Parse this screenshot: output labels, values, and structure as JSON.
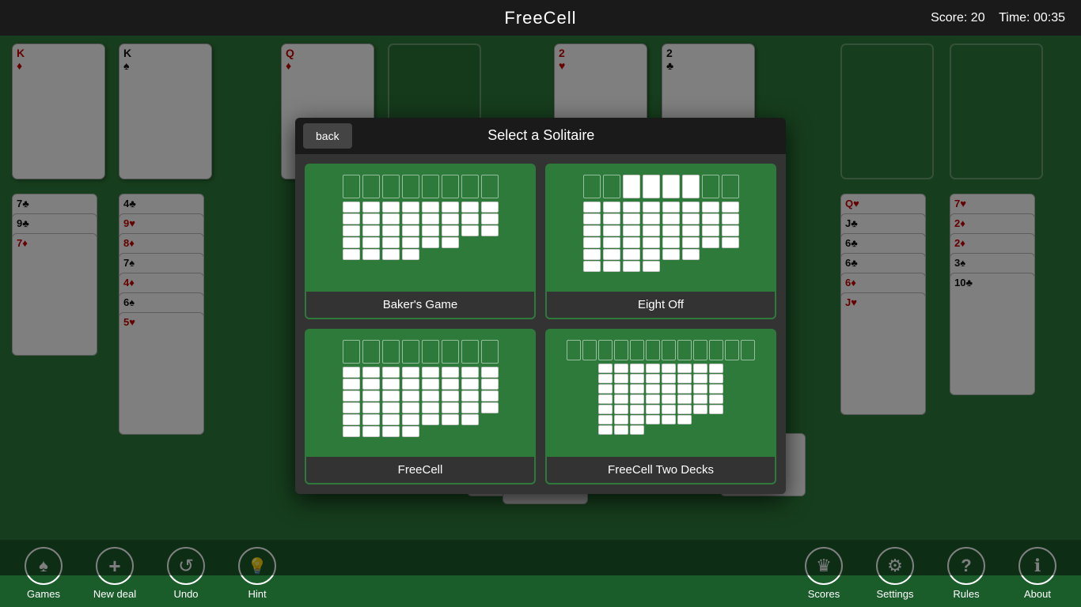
{
  "header": {
    "title": "FreeCell",
    "score_label": "Score:",
    "score_value": "20",
    "time_label": "Time:",
    "time_value": "00:35"
  },
  "toolbar": {
    "left_buttons": [
      {
        "id": "games",
        "label": "Games",
        "icon": "♠"
      },
      {
        "id": "new-deal",
        "label": "New deal",
        "icon": "+"
      },
      {
        "id": "undo",
        "label": "Undo",
        "icon": "↺"
      },
      {
        "id": "hint",
        "label": "Hint",
        "icon": "💡"
      }
    ],
    "right_buttons": [
      {
        "id": "scores",
        "label": "Scores",
        "icon": "♛"
      },
      {
        "id": "settings",
        "label": "Settings",
        "icon": "⚙"
      },
      {
        "id": "rules",
        "label": "Rules",
        "icon": "?"
      },
      {
        "id": "about",
        "label": "About",
        "icon": "ℹ"
      }
    ]
  },
  "modal": {
    "back_button": "back",
    "title": "Select a Solitaire",
    "options": [
      {
        "id": "bakers-game",
        "label": "Baker's Game"
      },
      {
        "id": "eight-off",
        "label": "Eight Off"
      },
      {
        "id": "freecell",
        "label": "FreeCell"
      },
      {
        "id": "freecell-two-decks",
        "label": "FreeCell Two Decks"
      }
    ]
  },
  "game": {
    "score": "Score: 20",
    "time": "Time: 00:35"
  }
}
